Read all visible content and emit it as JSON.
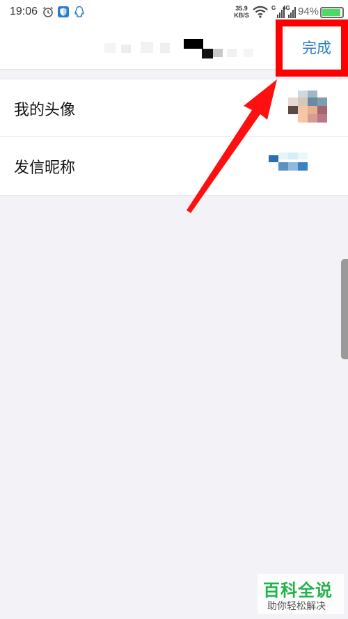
{
  "status_bar": {
    "time": "19:06",
    "net_speed_value": "35.9",
    "net_speed_unit": "KB/S",
    "signal_1_label": "G",
    "signal_2_label": "4G",
    "battery_percent": "94%",
    "battery_level": 0.94
  },
  "header": {
    "title": "",
    "done_label": "完成"
  },
  "settings": {
    "rows": [
      {
        "label": "我的头像"
      },
      {
        "label": "发信昵称"
      }
    ]
  },
  "colors": {
    "accent": "#2a7dc9",
    "highlight": "#ff0000",
    "background": "#f2f2f7"
  },
  "watermark": {
    "title": "百科全说",
    "subtitle": "助你轻松解决"
  }
}
